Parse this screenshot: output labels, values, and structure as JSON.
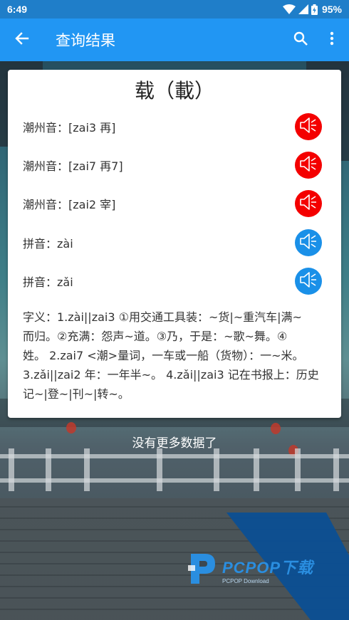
{
  "status_bar": {
    "time": "6:49",
    "battery_percent": "95%",
    "icons": [
      "wifi-icon",
      "signal-icon",
      "battery-charging-icon"
    ]
  },
  "app_bar": {
    "title": "查询结果",
    "back_icon": "arrow-back-icon",
    "search_icon": "search-icon",
    "more_icon": "more-vert-icon"
  },
  "card": {
    "character": "载（載）",
    "pronunciations": [
      {
        "label": "潮州音：[zai3 再]",
        "speaker_color": "#f40000"
      },
      {
        "label": "潮州音：[zai7 再7]",
        "speaker_color": "#f40000"
      },
      {
        "label": "潮州音：[zai2 宰]",
        "speaker_color": "#f40000"
      },
      {
        "label": "拼音：zài",
        "speaker_color": "#1a90e8"
      },
      {
        "label": "拼音：zǎi",
        "speaker_color": "#1a90e8"
      }
    ],
    "definition_lines": [
      "字义：1.zài||zai3 ①用交通工具装：~货|~重汽车|满~",
      "而归。②充满：怨声~道。③乃，于是：~歌~舞。④",
      "姓。 2.zai7 <潮>量词，一车或一船（货物）：一~米。",
      "3.zǎi||zai2 年：一年半~。 4.zǎi||zai3 记在书报上：历史",
      "记~|登~|刊~|转~。"
    ]
  },
  "footer": {
    "no_more_text": "没有更多数据了"
  },
  "watermark": {
    "brand": "PCPOP下载",
    "sub": "PCPOP Download"
  },
  "colors": {
    "status_bar": "#1f7ec9",
    "app_bar": "#2196f3",
    "speaker_red": "#f40000",
    "speaker_blue": "#1a90e8"
  }
}
